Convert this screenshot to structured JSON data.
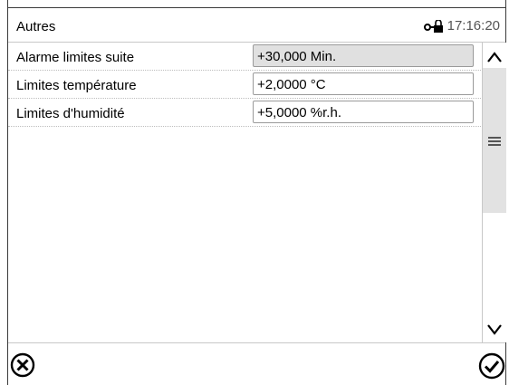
{
  "header": {
    "title": "Autres",
    "time": "17:16:20",
    "lock_icon": "lock-key-icon"
  },
  "settings": [
    {
      "label": "Alarme limites suite",
      "value": "+30,000 Min.",
      "readonly": true
    },
    {
      "label": "Limites température",
      "value": "+2,0000 °C",
      "readonly": false
    },
    {
      "label": "Limites d'humidité",
      "value": "+5,0000 %r.h.",
      "readonly": false
    }
  ],
  "scrollbar": {
    "up_icon": "chevron-up-icon",
    "grip_icon": "menu-icon",
    "down_icon": "chevron-down-icon"
  },
  "footer": {
    "cancel_icon": "cancel-circle-x-icon",
    "confirm_icon": "confirm-circle-check-icon"
  },
  "colors": {
    "readonly_field": "#e0e0e0",
    "scroll_thumb": "#e2e2e2",
    "frame": "#3a3a3a"
  }
}
